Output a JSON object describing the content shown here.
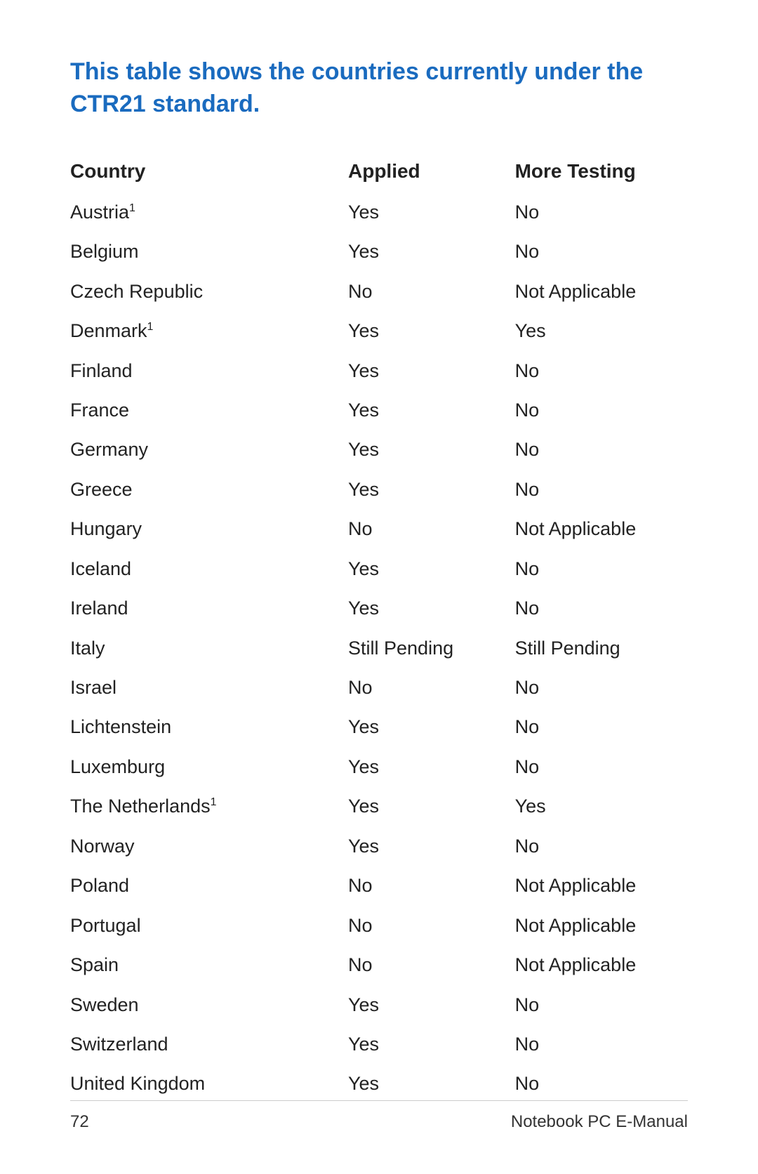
{
  "title": "This table shows the countries currently under the CTR21 standard.",
  "table": {
    "headers": [
      "Country",
      "Applied",
      "More Testing"
    ],
    "rows": [
      {
        "country": "Austria",
        "country_sup": "1",
        "applied": "Yes",
        "more_testing": "No"
      },
      {
        "country": "Belgium",
        "country_sup": "",
        "applied": "Yes",
        "more_testing": "No"
      },
      {
        "country": "Czech Republic",
        "country_sup": "",
        "applied": "No",
        "more_testing": "Not Applicable"
      },
      {
        "country": "Denmark",
        "country_sup": "1",
        "applied": "Yes",
        "more_testing": "Yes"
      },
      {
        "country": "Finland",
        "country_sup": "",
        "applied": "Yes",
        "more_testing": "No"
      },
      {
        "country": "France",
        "country_sup": "",
        "applied": "Yes",
        "more_testing": "No"
      },
      {
        "country": "Germany",
        "country_sup": "",
        "applied": "Yes",
        "more_testing": "No"
      },
      {
        "country": "Greece",
        "country_sup": "",
        "applied": "Yes",
        "more_testing": "No"
      },
      {
        "country": "Hungary",
        "country_sup": "",
        "applied": "No",
        "more_testing": "Not Applicable"
      },
      {
        "country": "Iceland",
        "country_sup": "",
        "applied": "Yes",
        "more_testing": "No"
      },
      {
        "country": "Ireland",
        "country_sup": "",
        "applied": "Yes",
        "more_testing": "No"
      },
      {
        "country": "Italy",
        "country_sup": "",
        "applied": "Still Pending",
        "more_testing": "Still Pending"
      },
      {
        "country": "Israel",
        "country_sup": "",
        "applied": "No",
        "more_testing": "No"
      },
      {
        "country": "Lichtenstein",
        "country_sup": "",
        "applied": "Yes",
        "more_testing": "No"
      },
      {
        "country": "Luxemburg",
        "country_sup": "",
        "applied": "Yes",
        "more_testing": "No"
      },
      {
        "country": "The Netherlands",
        "country_sup": "1",
        "applied": "Yes",
        "more_testing": "Yes"
      },
      {
        "country": "Norway",
        "country_sup": "",
        "applied": "Yes",
        "more_testing": "No"
      },
      {
        "country": "Poland",
        "country_sup": "",
        "applied": "No",
        "more_testing": "Not Applicable"
      },
      {
        "country": "Portugal",
        "country_sup": "",
        "applied": "No",
        "more_testing": "Not Applicable"
      },
      {
        "country": "Spain",
        "country_sup": "",
        "applied": "No",
        "more_testing": "Not Applicable"
      },
      {
        "country": "Sweden",
        "country_sup": "",
        "applied": "Yes",
        "more_testing": "No"
      },
      {
        "country": "Switzerland",
        "country_sup": "",
        "applied": "Yes",
        "more_testing": "No"
      },
      {
        "country": "United Kingdom",
        "country_sup": "",
        "applied": "Yes",
        "more_testing": "No"
      }
    ]
  },
  "footer": {
    "page_number": "72",
    "book_title": "Notebook PC E-Manual"
  }
}
